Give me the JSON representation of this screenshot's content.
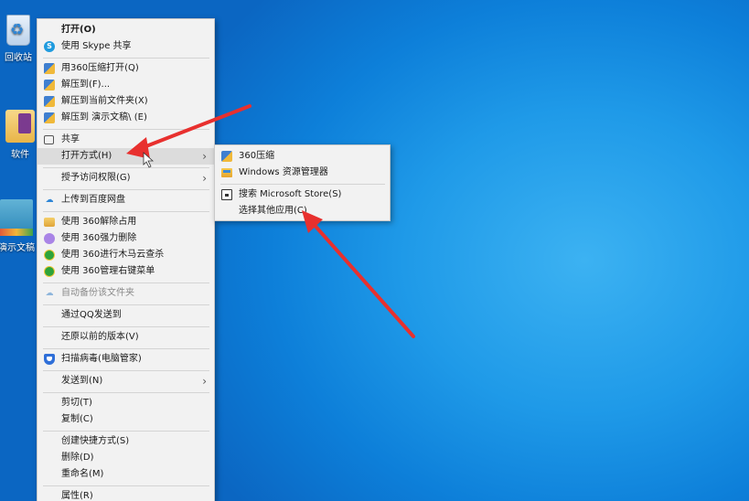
{
  "desktop": {
    "icons": [
      {
        "label": "回收站",
        "icon": "recycle-bin-icon"
      },
      {
        "label": "软件",
        "icon": "folder-icon"
      },
      {
        "label": "演示文稿",
        "icon": "document-icon"
      }
    ]
  },
  "context_menu": {
    "items": [
      {
        "label": "打开(O)",
        "bold": true
      },
      {
        "label": "使用 Skype 共享",
        "icon": "skype-icon"
      },
      {
        "label": "用360压缩打开(Q)",
        "icon": "360-zip-icon"
      },
      {
        "label": "解压到(F)...",
        "icon": "360-zip-icon"
      },
      {
        "label": "解压到当前文件夹(X)",
        "icon": "360-zip-icon"
      },
      {
        "label": "解压到 演示文稿\\ (E)",
        "icon": "360-zip-icon"
      },
      {
        "label": "共享",
        "icon": "share-icon"
      },
      {
        "label": "打开方式(H)",
        "submenu": true,
        "highlighted": true
      },
      {
        "label": "授予访问权限(G)",
        "submenu": true
      },
      {
        "label": "上传到百度网盘",
        "icon": "baidu-cloud-icon"
      },
      {
        "label": "使用 360解除占用",
        "icon": "360-unlock-icon"
      },
      {
        "label": "使用 360强力删除",
        "icon": "360-delete-icon"
      },
      {
        "label": "使用 360进行木马云查杀",
        "icon": "360-scan-icon"
      },
      {
        "label": "使用 360管理右键菜单",
        "icon": "360-manage-icon"
      },
      {
        "label": "自动备份该文件夹",
        "icon": "baidu-cloud-icon",
        "disabled": true
      },
      {
        "label": "通过QQ发送到"
      },
      {
        "label": "还原以前的版本(V)"
      },
      {
        "label": "扫描病毒(电脑管家)",
        "icon": "tencent-shield-icon"
      },
      {
        "label": "发送到(N)",
        "submenu": true
      },
      {
        "label": "剪切(T)"
      },
      {
        "label": "复制(C)"
      },
      {
        "label": "创建快捷方式(S)"
      },
      {
        "label": "删除(D)"
      },
      {
        "label": "重命名(M)"
      },
      {
        "label": "属性(R)"
      }
    ]
  },
  "open_with_submenu": {
    "items": [
      {
        "label": "360压缩",
        "icon": "360-zip-icon"
      },
      {
        "label": "Windows 资源管理器",
        "icon": "file-explorer-icon"
      },
      {
        "label": "搜索 Microsoft Store(S)",
        "icon": "microsoft-store-icon"
      },
      {
        "label": "选择其他应用(C)"
      }
    ]
  },
  "annotations": {
    "arrow_color": "#e8302e"
  }
}
